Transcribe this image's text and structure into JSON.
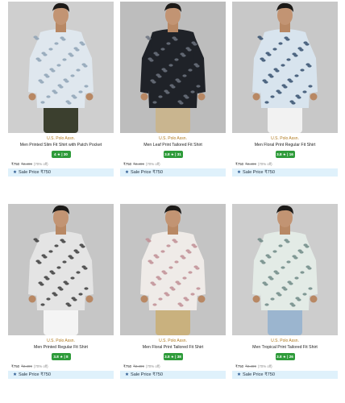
{
  "products": [
    {
      "brand": "U.S. Polo Assn.",
      "title": "Men Printed Slim Fit Shirt with Patch Pocket",
      "rating": "4 ★ | 30",
      "price": "₹750",
      "mrp": "₹2,499",
      "discount": "(70% off)",
      "sale_label": "Sale Price ₹750",
      "bg": "#cfcfcf",
      "shirt": "#dfe7ee",
      "pattern": "#8fa3b6",
      "pant": "#3b3f2e"
    },
    {
      "brand": "U.S. Polo Assn.",
      "title": "Men Leaf Print Tailored Fit Shirt",
      "rating": "3.8 ★ | 31",
      "price": "₹750",
      "mrp": "₹2,499",
      "discount": "(70% off)",
      "sale_label": "Sale Price ₹750",
      "bg": "#bdbdbd",
      "shirt": "#1f2228",
      "pattern": "#6d7480",
      "pant": "#c9b58f"
    },
    {
      "brand": "U.S. Polo Assn.",
      "title": "Men Floral Print Regular Fit Shirt",
      "rating": "3.8 ★ | 16",
      "price": "₹750",
      "mrp": "₹2,499",
      "discount": "(70% off)",
      "sale_label": "Sale Price ₹750",
      "bg": "#c8c8c8",
      "shirt": "#d8e4ee",
      "pattern": "#35506e",
      "pant": "#f2f2f2"
    },
    {
      "brand": "U.S. Polo Assn.",
      "title": "Men Printed Regular Fit Shirt",
      "rating": "3.8 ★ | 8",
      "price": "₹750",
      "mrp": "₹2,499",
      "discount": "(70% off)",
      "sale_label": "Sale Price ₹750",
      "bg": "#c6c6c6",
      "shirt": "#e4e4e4",
      "pattern": "#3c3c3c",
      "pant": "#f4f4f4"
    },
    {
      "brand": "U.S. Polo Assn.",
      "title": "Men Floral Print Tailored Fit Shirt",
      "rating": "3.8 ★ | 38",
      "price": "₹750",
      "mrp": "₹2,499",
      "discount": "(70% off)",
      "sale_label": "Sale Price ₹750",
      "bg": "#c4c4c4",
      "shirt": "#efebe8",
      "pattern": "#c18f95",
      "pant": "#c9b17e"
    },
    {
      "brand": "U.S. Polo Assn.",
      "title": "Men Tropical Print Tailored Fit Shirt",
      "rating": "3.8 ★ | 26",
      "price": "₹750",
      "mrp": "₹2,499",
      "discount": "(70% off)",
      "sale_label": "Sale Price ₹750",
      "bg": "#cdcdcd",
      "shirt": "#e3ebe6",
      "pattern": "#6f8a86",
      "pant": "#9bb5cf"
    }
  ]
}
